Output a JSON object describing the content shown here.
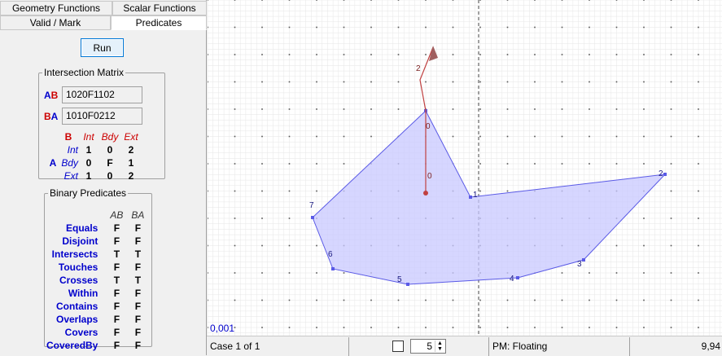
{
  "tabs_row1": [
    "Geometry Functions",
    "Scalar Functions"
  ],
  "tabs_row2": [
    "Valid / Mark",
    "Predicates"
  ],
  "run_label": "Run",
  "intersection_matrix": {
    "title": "Intersection Matrix",
    "ab_label_a": "A",
    "ab_label_b": "B",
    "ab_value": "1020F1102",
    "ba_label_b": "B",
    "ba_label_a": "A",
    "ba_value": "1010F0212",
    "col_header": "B",
    "row_header": "A",
    "cols": [
      "Int",
      "Bdy",
      "Ext"
    ],
    "rows": [
      {
        "name": "Int",
        "values": [
          "1",
          "0",
          "2"
        ]
      },
      {
        "name": "Bdy",
        "values": [
          "0",
          "F",
          "1"
        ]
      },
      {
        "name": "Ext",
        "values": [
          "1",
          "0",
          "2"
        ]
      }
    ]
  },
  "binary_predicates": {
    "title": "Binary Predicates",
    "headers": [
      "AB",
      "BA"
    ],
    "rows": [
      {
        "name": "Equals",
        "ab": "F",
        "ba": "F"
      },
      {
        "name": "Disjoint",
        "ab": "F",
        "ba": "F"
      },
      {
        "name": "Intersects",
        "ab": "T",
        "ba": "T"
      },
      {
        "name": "Touches",
        "ab": "F",
        "ba": "F"
      },
      {
        "name": "Crosses",
        "ab": "T",
        "ba": "T"
      },
      {
        "name": "Within",
        "ab": "F",
        "ba": "F"
      },
      {
        "name": "Contains",
        "ab": "F",
        "ba": "F"
      },
      {
        "name": "Overlaps",
        "ab": "F",
        "ba": "F"
      },
      {
        "name": "Covers",
        "ab": "F",
        "ba": "F"
      },
      {
        "name": "CoveredBy",
        "ab": "F",
        "ba": "F"
      }
    ]
  },
  "canvas": {
    "scale_label": "0,001",
    "polygon_vertex_labels": [
      "1",
      "2",
      "3",
      "4",
      "5",
      "6",
      "7"
    ],
    "line_vertex_labels": [
      "0",
      "0",
      "2"
    ],
    "colors": {
      "polygon_fill": "#c8c8ff",
      "polygon_stroke": "#5a5ae6",
      "line": "#c04040",
      "grid": "#e6e6e6"
    }
  },
  "status_bar": {
    "case": "Case 1 of 1",
    "spinner_value": "5",
    "precision_model": "PM: Floating",
    "coords": "9,94"
  }
}
